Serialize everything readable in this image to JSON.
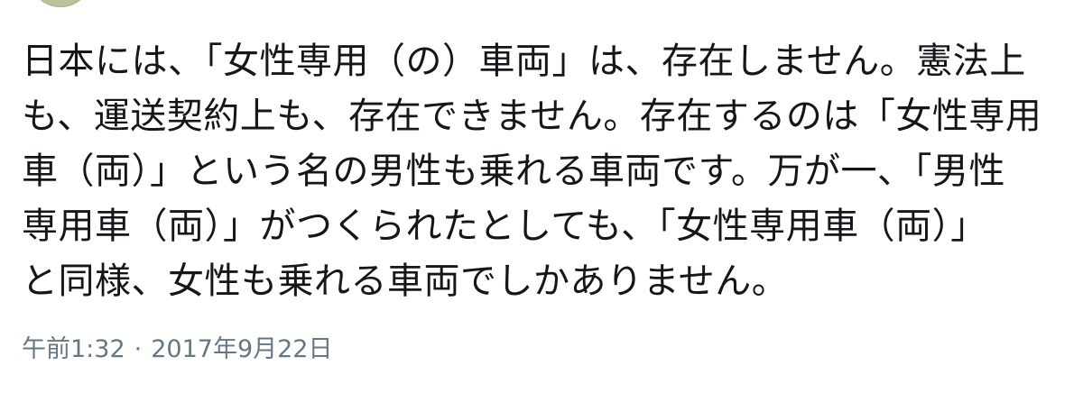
{
  "tweet": {
    "lines": [
      "日本には、「女性専用（の）車両」は、存在しません。憲法上",
      "も、運送契約上も、存在できません。存在するのは「女性専用",
      "車（両）」という名の男性も乗れる車両です。万が一、「男性",
      "専用車（両）」がつくられたとしても、「女性専用車（両）」",
      "と同様、女性も乗れる車両でしかありません。"
    ],
    "time": "午前1:32",
    "separator": "·",
    "date": "2017年9月22日"
  },
  "colors": {
    "text": "#14171a",
    "meta": "#657786",
    "avatar": "#b9c29a"
  }
}
